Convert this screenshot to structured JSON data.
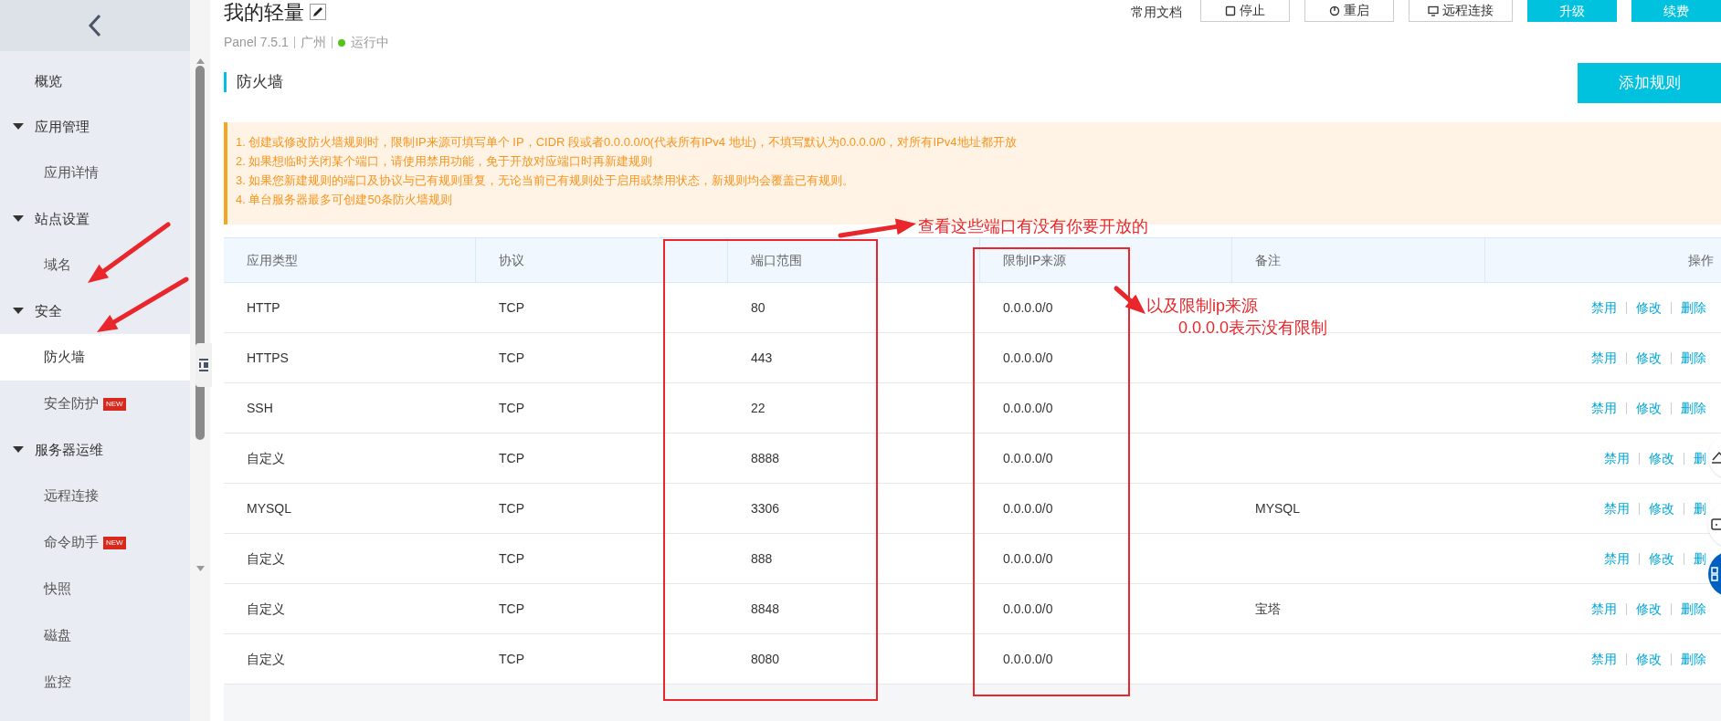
{
  "header": {
    "title": "我的轻量",
    "subtitle": [
      "Panel 7.5.1",
      "广州"
    ],
    "status": {
      "label": "运行中",
      "color": "#52c41a"
    },
    "docs_link": "常用文档",
    "buttons": [
      {
        "label": "停止",
        "kind": "outline"
      },
      {
        "label": "重启",
        "kind": "outline"
      },
      {
        "label": "远程连接",
        "kind": "outline"
      },
      {
        "label": "升级",
        "kind": "primary"
      },
      {
        "label": "续费",
        "kind": "primary"
      }
    ]
  },
  "sidebar": {
    "items": [
      {
        "label": "概览",
        "kind": "top",
        "selected": false
      },
      {
        "label": "应用管理",
        "kind": "group",
        "expanded": true,
        "children": [
          {
            "label": "应用详情",
            "selected": false
          }
        ]
      },
      {
        "label": "站点设置",
        "kind": "group",
        "expanded": true,
        "children": [
          {
            "label": "域名",
            "selected": false
          }
        ]
      },
      {
        "label": "安全",
        "kind": "group",
        "expanded": true,
        "children": [
          {
            "label": "防火墙",
            "selected": true
          },
          {
            "label": "安全防护",
            "badge": "NEW",
            "selected": false
          }
        ]
      },
      {
        "label": "服务器运维",
        "kind": "group",
        "expanded": true,
        "children": [
          {
            "label": "远程连接",
            "selected": false
          },
          {
            "label": "命令助手",
            "badge": "NEW",
            "selected": false
          },
          {
            "label": "快照",
            "selected": false
          },
          {
            "label": "磁盘",
            "selected": false
          },
          {
            "label": "监控",
            "selected": false
          }
        ]
      }
    ]
  },
  "section": {
    "title": "防火墙",
    "add_button": "添加规则"
  },
  "notice": [
    "1. 创建或修改防火墙规则时，限制IP来源可填写单个 IP，CIDR 段或者0.0.0.0/0(代表所有IPv4 地址)，不填写默认为0.0.0.0/0，对所有IPv4地址都开放",
    "2. 如果想临时关闭某个端口，请使用禁用功能，免于开放对应端口时再新建规则",
    "3. 如果您新建规则的端口及协议与已有规则重复，无论当前已有规则处于启用或禁用状态，新规则均会覆盖已有规则。",
    "4. 单台服务器最多可创建50条防火墙规则"
  ],
  "table": {
    "columns": [
      "应用类型",
      "协议",
      "端口范围",
      "限制IP来源",
      "备注",
      "操作"
    ],
    "rows": [
      {
        "type": "HTTP",
        "protocol": "TCP",
        "ports": "80",
        "source": "0.0.0.0/0",
        "actions": [
          "禁用",
          "修改",
          "删除"
        ]
      },
      {
        "type": "HTTPS",
        "protocol": "TCP",
        "ports": "443",
        "source": "0.0.0.0/0",
        "actions": [
          "禁用",
          "修改",
          "删除"
        ]
      },
      {
        "type": "SSH",
        "protocol": "TCP",
        "ports": "22",
        "source": "0.0.0.0/0",
        "actions": [
          "禁用",
          "修改",
          "删除"
        ]
      },
      {
        "type": "自定义",
        "protocol": "TCP",
        "ports": "8888",
        "source": "0.0.0.0/0",
        "actions": [
          "禁用",
          "修改",
          "删"
        ]
      },
      {
        "type": "MYSQL",
        "protocol": "TCP",
        "ports": "3306",
        "source": "0.0.0.0/0",
        "note": "MYSQL",
        "actions": [
          "禁用",
          "修改",
          "删"
        ]
      },
      {
        "type": "自定义",
        "protocol": "TCP",
        "ports": "888",
        "source": "0.0.0.0/0",
        "actions": [
          "禁用",
          "修改",
          "删"
        ]
      },
      {
        "type": "自定义",
        "protocol": "TCP",
        "ports": "8848",
        "source": "0.0.0.0/0",
        "note": "宝塔",
        "actions": [
          "禁用",
          "修改",
          "删除"
        ]
      },
      {
        "type": "自定义",
        "protocol": "TCP",
        "ports": "8080",
        "source": "0.0.0.0/0",
        "actions": [
          "禁用",
          "修改",
          "删除"
        ]
      }
    ]
  },
  "annotations": [
    "查看这些端口有没有你要开放的",
    "以及限制ip来源",
    "0.0.0.0表示没有限制"
  ]
}
